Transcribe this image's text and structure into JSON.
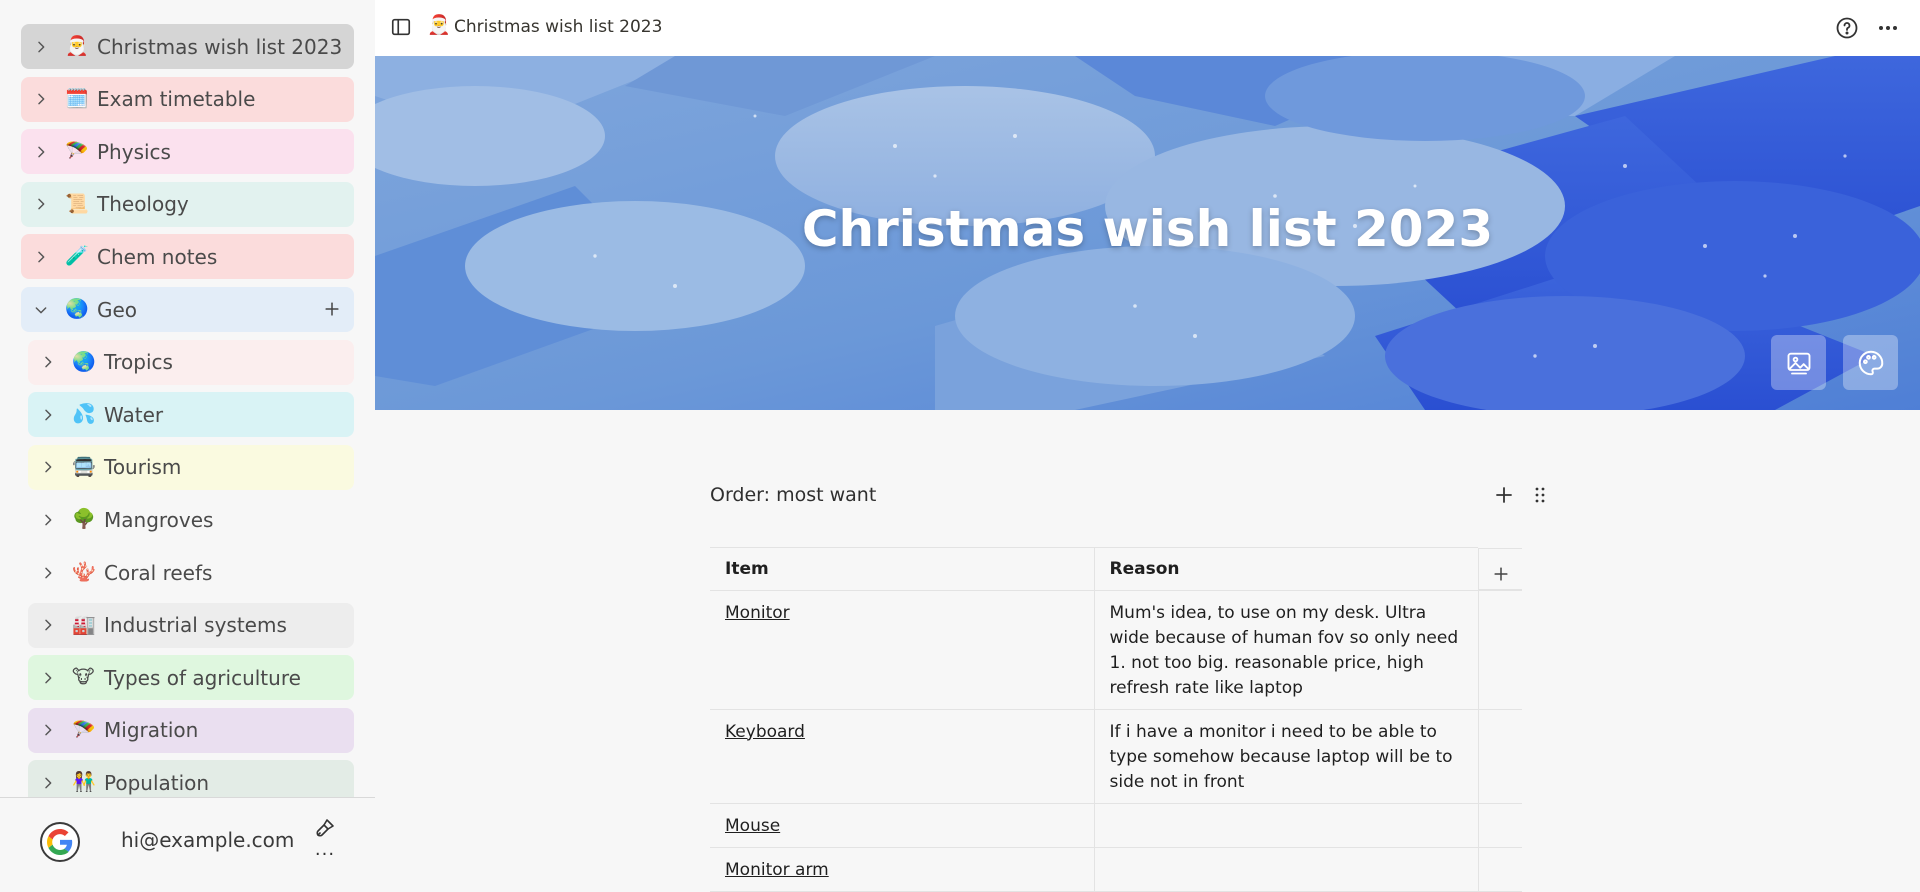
{
  "sidebar": {
    "items": [
      {
        "label": "Christmas wish list 2023",
        "emoji": "🎅",
        "bg": "#d5d5d5",
        "expanded": false
      },
      {
        "label": "Exam timetable",
        "emoji": "🗓️",
        "bg": "#fbdcdc",
        "expanded": false
      },
      {
        "label": "Physics",
        "emoji": "🪂",
        "bg": "#fbe1ee",
        "expanded": false
      },
      {
        "label": "Theology",
        "emoji": "📜",
        "bg": "#e2f2ef",
        "expanded": false
      },
      {
        "label": "Chem notes",
        "emoji": "🧪",
        "bg": "#fbdcdc",
        "expanded": false
      },
      {
        "label": "Geo",
        "emoji": "🌏",
        "bg": "#e3edf8",
        "expanded": true
      },
      {
        "label": "Tropics",
        "emoji": "🌏",
        "bg": "#fbeeee",
        "expanded": false
      },
      {
        "label": "Water",
        "emoji": "💦",
        "bg": "#d9f3f5",
        "expanded": false
      },
      {
        "label": "Tourism",
        "emoji": "🚍",
        "bg": "#fafae0",
        "expanded": false
      },
      {
        "label": "Mangroves",
        "emoji": "🌳",
        "bg": "#f7f7f7",
        "expanded": false
      },
      {
        "label": "Coral reefs",
        "emoji": "🪸",
        "bg": "#f7f7f7",
        "expanded": false
      },
      {
        "label": "Industrial systems",
        "emoji": "🏭",
        "bg": "#ededed",
        "expanded": false
      },
      {
        "label": "Types of agriculture",
        "emoji": "🐮",
        "bg": "#dff7df",
        "expanded": false
      },
      {
        "label": "Migration",
        "emoji": "🪂",
        "bg": "#eadff0",
        "expanded": false
      },
      {
        "label": "Population",
        "emoji": "👫",
        "bg": "#e3ece6",
        "expanded": false
      }
    ]
  },
  "footer": {
    "email": "hi@example.com",
    "more": "..."
  },
  "topbar": {
    "emoji": "🎅",
    "title": "Christmas wish list 2023"
  },
  "cover": {
    "title": "Christmas wish list 2023"
  },
  "block": {
    "title": "Order: most want"
  },
  "table": {
    "headers": [
      "Item",
      "Reason"
    ],
    "rows": [
      {
        "item": "Monitor",
        "reason": "Mum's idea, to use on my desk. Ultra wide because of human fov so only need 1. not too big. reasonable price, high refresh rate like laptop"
      },
      {
        "item": "Keyboard",
        "reason": "If i have a monitor i need to be able to type somehow because laptop will be to side not in front"
      },
      {
        "item": "Mouse",
        "reason": ""
      },
      {
        "item": "Monitor arm",
        "reason": ""
      }
    ]
  },
  "colors": {
    "accent": "#4a73d6",
    "cover_dark": "#2f54d8",
    "cover_light": "#9fbde6"
  }
}
